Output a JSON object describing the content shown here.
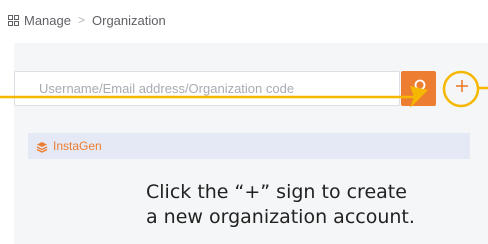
{
  "breadcrumb": {
    "icon": "grid-icon",
    "root": "Manage",
    "separator": ">",
    "current": "Organization"
  },
  "search": {
    "placeholder": "Username/Email address/Organization code",
    "value": "",
    "button_icon": "search-icon"
  },
  "add_button": {
    "icon": "plus-icon",
    "label": "+"
  },
  "organization": {
    "icon": "stack-icon",
    "name": "InstaGen"
  },
  "callout": {
    "line1": "Click the “+” sign to create",
    "line2": "a new organization account."
  },
  "colors": {
    "accent": "#ed7d31",
    "annotation": "#f5b700",
    "row_bg": "#e4e9f5",
    "panel_bg": "#f5f6f7"
  }
}
